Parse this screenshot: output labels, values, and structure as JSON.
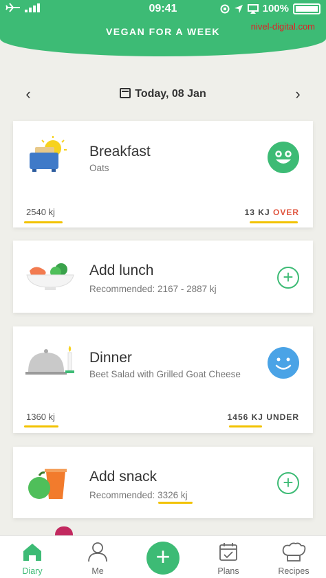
{
  "status": {
    "time": "09:41",
    "battery": "100%"
  },
  "watermark": "nivel-digital.com",
  "header": {
    "title": "VEGAN FOR A WEEK"
  },
  "date_nav": {
    "label": "Today, 08 Jan",
    "prev": "‹",
    "next": "›"
  },
  "meals": {
    "breakfast": {
      "title": "Breakfast",
      "subtitle": "Oats",
      "kj": "2540 kj",
      "status_value": "13 KJ",
      "status_word": "OVER"
    },
    "lunch": {
      "title": "Add lunch",
      "subtitle": "Recommended: 2167 - 2887  kj"
    },
    "dinner": {
      "title": "Dinner",
      "subtitle": "Beet Salad with Grilled Goat Cheese",
      "kj": "1360 kj",
      "status_value": "1456 KJ",
      "status_word": "UNDER"
    },
    "snack": {
      "title": "Add snack",
      "subtitle_prefix": "Recommended: ",
      "subtitle_value": "3326  kj"
    }
  },
  "nav": {
    "tabs": [
      {
        "label": "Diary",
        "icon": "home-icon"
      },
      {
        "label": "Me",
        "icon": "person-icon"
      },
      {
        "label": "Plans",
        "icon": "calendar-check-icon"
      },
      {
        "label": "Recipes",
        "icon": "chef-hat-icon"
      }
    ],
    "fab": "+"
  },
  "colors": {
    "brand": "#3dbb75",
    "over": "#e0543e",
    "underline": "#f2c200",
    "face_happy": "#3dbb75",
    "face_blue": "#4aa3e6"
  }
}
